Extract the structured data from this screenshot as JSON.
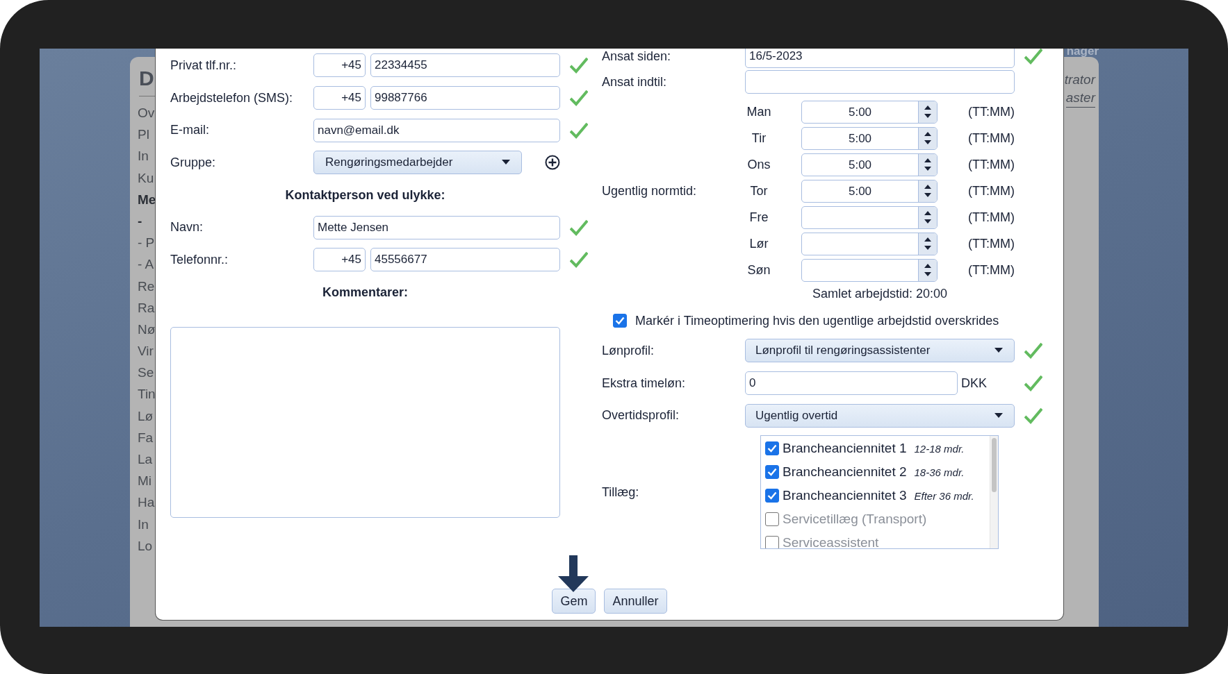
{
  "background_app": {
    "title": "D",
    "header_texts": [
      "nager"
    ],
    "user_texts": [
      "trator",
      "aster"
    ],
    "menu": [
      {
        "label": "Ov",
        "selected": false
      },
      {
        "label": "Pl",
        "selected": false
      },
      {
        "label": "In",
        "selected": false
      },
      {
        "label": "Ku",
        "selected": false
      },
      {
        "label": "Me",
        "selected": true
      },
      {
        "label": "-",
        "selected": true
      },
      {
        "label": "- P",
        "selected": false
      },
      {
        "label": "- A",
        "selected": false
      },
      {
        "label": "Re",
        "selected": false
      },
      {
        "label": "Ra",
        "selected": false
      },
      {
        "label": "Nø",
        "selected": false
      },
      {
        "label": "Vir",
        "selected": false
      },
      {
        "label": "Se",
        "selected": false
      },
      {
        "label": "Tin",
        "selected": false
      },
      {
        "label": "Lø",
        "selected": false
      },
      {
        "label": "Fa",
        "selected": false
      },
      {
        "label": "La",
        "selected": false
      },
      {
        "label": "Mi",
        "selected": false
      },
      {
        "label": "Ha",
        "selected": false
      },
      {
        "label": "In",
        "selected": false
      },
      {
        "label": "Lo",
        "selected": false
      }
    ]
  },
  "left_rows": [
    {
      "kind": "phone",
      "label": "Privat tlf.nr.:",
      "prefix": "+45",
      "value": "22334455",
      "valid": true
    },
    {
      "kind": "phone",
      "label": "Arbejdstelefon (SMS):",
      "prefix": "+45",
      "value": "99887766",
      "valid": true
    },
    {
      "kind": "text",
      "label": "E-mail:",
      "value": "navn@email.dk",
      "valid": true
    },
    {
      "kind": "select_add",
      "label": "Gruppe:",
      "value": "Rengøringsmedarbejder",
      "valid": false
    },
    {
      "kind": "heading",
      "label": "Kontaktperson ved ulykke:"
    },
    {
      "kind": "text",
      "label": "Navn:",
      "value": "Mette Jensen",
      "valid": true
    },
    {
      "kind": "phone",
      "label": "Telefonnr.:",
      "prefix": "+45",
      "value": "45556677",
      "valid": true
    },
    {
      "kind": "heading",
      "label": "Kommentarer:"
    },
    {
      "kind": "textarea"
    }
  ],
  "right_top": [
    {
      "kind": "text",
      "label": "Ansat siden:",
      "value": "16/5-2023",
      "valid": true
    },
    {
      "kind": "text",
      "label": "Ansat indtil:",
      "valid": false
    }
  ],
  "weekly": {
    "label": "Ugentlig normtid:",
    "total": "Samlet arbejdstid: 20:00",
    "days": [
      {
        "day": "Man",
        "value": "5:00",
        "unit": "(TT:MM)"
      },
      {
        "day": "Tir",
        "value": "5:00",
        "unit": "(TT:MM)"
      },
      {
        "day": "Ons",
        "value": "5:00",
        "unit": "(TT:MM)"
      },
      {
        "day": "Tor",
        "value": "5:00",
        "unit": "(TT:MM)"
      },
      {
        "day": "Fre",
        "unit": "(TT:MM)"
      },
      {
        "day": "Lør",
        "unit": "(TT:MM)"
      },
      {
        "day": "Søn",
        "unit": "(TT:MM)"
      }
    ]
  },
  "flag_checkbox": {
    "label": "Markér i Timeoptimering hvis den ugentlige arbejdstid overskrides",
    "checked": true
  },
  "right_bottom": [
    {
      "kind": "select",
      "label": "Lønprofil:",
      "value": "Lønprofil til rengøringsassistenter",
      "valid": true
    },
    {
      "kind": "text_suffix",
      "label": "Ekstra timeløn:",
      "value": "0",
      "suffix": "DKK",
      "valid": true
    },
    {
      "kind": "select",
      "label": "Overtidsprofil:",
      "value": "Ugentlig overtid",
      "valid": true
    }
  ],
  "supplements": {
    "label": "Tillæg:",
    "items": [
      {
        "name": "Brancheanciennitet 1",
        "note": "12-18 mdr.",
        "checked": true
      },
      {
        "name": "Brancheanciennitet 2",
        "note": "18-36 mdr.",
        "checked": true
      },
      {
        "name": "Brancheanciennitet 3",
        "note": "Efter 36 mdr.",
        "checked": true
      },
      {
        "name": "Servicetillæg (Transport)",
        "checked": false
      },
      {
        "name": "Serviceassistent",
        "checked": false
      }
    ]
  },
  "buttons": [
    {
      "label": "Gem",
      "highlighted": true
    },
    {
      "label": "Annuller",
      "highlighted": false
    }
  ]
}
